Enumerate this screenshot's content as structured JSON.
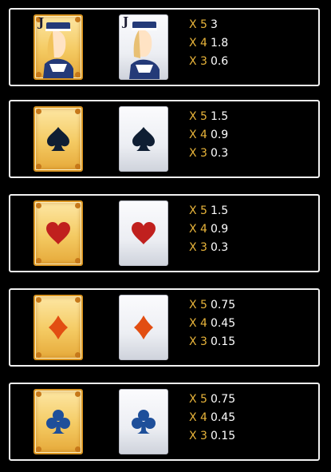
{
  "colors": {
    "background": "#000000",
    "panel_border": "#f2f2f2",
    "multiplier": "#e8b43a",
    "value": "#ffffff",
    "spade": "#0f1e33",
    "heart": "#c0201e",
    "diamond": "#e24e12",
    "club": "#1e4f9a"
  },
  "paytable": [
    {
      "symbol": "jack",
      "icon": "jack-card-icon",
      "card_letter": "J",
      "payouts": [
        {
          "mult": "X 5",
          "value": "3"
        },
        {
          "mult": "X 4",
          "value": "1.8"
        },
        {
          "mult": "X 3",
          "value": "0.6"
        }
      ]
    },
    {
      "symbol": "spade",
      "icon": "spade-icon",
      "payouts": [
        {
          "mult": "X 5",
          "value": "1.5"
        },
        {
          "mult": "X 4",
          "value": "0.9"
        },
        {
          "mult": "X 3",
          "value": "0.3"
        }
      ]
    },
    {
      "symbol": "heart",
      "icon": "heart-icon",
      "payouts": [
        {
          "mult": "X 5",
          "value": "1.5"
        },
        {
          "mult": "X 4",
          "value": "0.9"
        },
        {
          "mult": "X 3",
          "value": "0.3"
        }
      ]
    },
    {
      "symbol": "diamond",
      "icon": "diamond-icon",
      "payouts": [
        {
          "mult": "X 5",
          "value": "0.75"
        },
        {
          "mult": "X 4",
          "value": "0.45"
        },
        {
          "mult": "X 3",
          "value": "0.15"
        }
      ]
    },
    {
      "symbol": "club",
      "icon": "club-icon",
      "payouts": [
        {
          "mult": "X 5",
          "value": "0.75"
        },
        {
          "mult": "X 4",
          "value": "0.45"
        },
        {
          "mult": "X 3",
          "value": "0.15"
        }
      ]
    }
  ]
}
